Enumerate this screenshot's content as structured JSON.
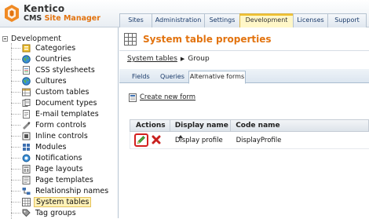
{
  "header": {
    "logo_name": "Kentico",
    "logo_sub_prefix": "CMS ",
    "logo_sub_accent": "Site Manager",
    "tabs": [
      {
        "label": "Sites"
      },
      {
        "label": "Administration"
      },
      {
        "label": "Settings"
      },
      {
        "label": "Development",
        "active": true
      },
      {
        "label": "Licenses"
      },
      {
        "label": "Support"
      }
    ]
  },
  "tree": {
    "root_label": "Development",
    "items": [
      {
        "label": "Categories",
        "icon": "categories-icon"
      },
      {
        "label": "Countries",
        "icon": "globe-icon"
      },
      {
        "label": "CSS stylesheets",
        "icon": "css-icon"
      },
      {
        "label": "Cultures",
        "icon": "globe-icon"
      },
      {
        "label": "Custom tables",
        "icon": "table-icon"
      },
      {
        "label": "Document types",
        "icon": "document-icon"
      },
      {
        "label": "E-mail templates",
        "icon": "email-icon"
      },
      {
        "label": "Form controls",
        "icon": "form-icon"
      },
      {
        "label": "Inline controls",
        "icon": "inline-icon"
      },
      {
        "label": "Modules",
        "icon": "modules-icon"
      },
      {
        "label": "Notifications",
        "icon": "notifications-icon"
      },
      {
        "label": "Page layouts",
        "icon": "layout-icon"
      },
      {
        "label": "Page templates",
        "icon": "template-icon"
      },
      {
        "label": "Relationship names",
        "icon": "relationship-icon"
      },
      {
        "label": "System tables",
        "icon": "grid-icon",
        "selected": true
      },
      {
        "label": "Tag groups",
        "icon": "tag-icon"
      }
    ]
  },
  "content": {
    "title": "System table properties",
    "breadcrumb": {
      "parent": "System tables",
      "current": "Group"
    },
    "subtabs": [
      {
        "label": "Fields"
      },
      {
        "label": "Queries"
      },
      {
        "label": "Alternative forms",
        "active": true
      }
    ],
    "create_link": "Create new form",
    "grid": {
      "headers": {
        "actions": "Actions",
        "display_name": "Display name",
        "code_name": "Code name"
      },
      "rows": [
        {
          "display_name": "Display profile",
          "code_name": "DisplayProfile"
        }
      ]
    }
  },
  "colors": {
    "accent": "#e2730f",
    "selected_bg": "#fff2b8",
    "highlight_border": "#d42020"
  }
}
